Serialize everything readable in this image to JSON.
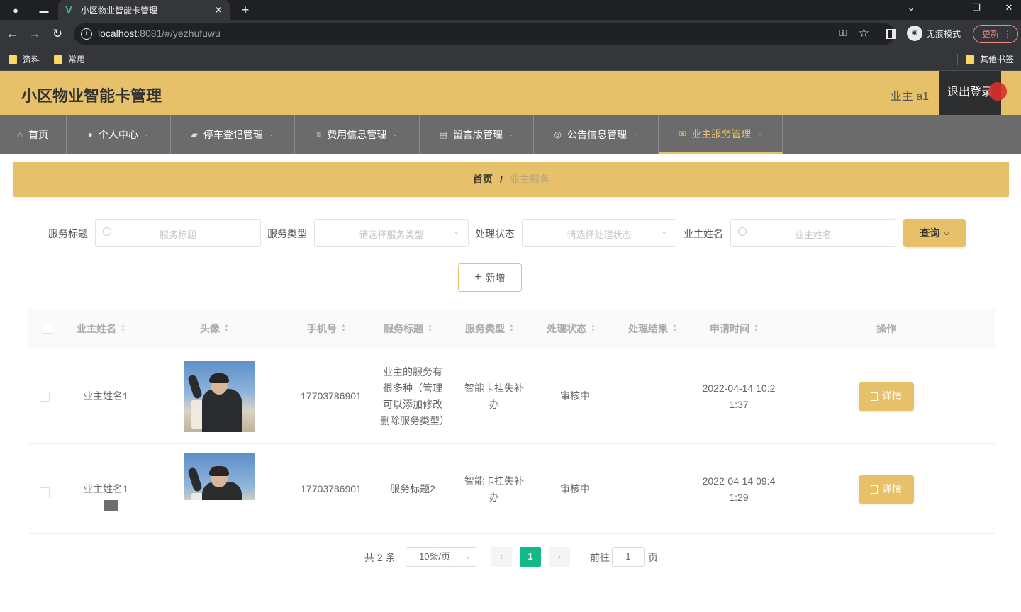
{
  "browser": {
    "tab_title": "小区物业智能卡管理",
    "tab_logo": "V",
    "url_host": "localhost",
    "url_rest": ":8081/#/yezhufuwu",
    "incognito_label": "无痕模式",
    "update_label": "更新",
    "bookmarks": [
      "资料",
      "常用"
    ],
    "other_bookmarks": "其他书签",
    "icons": [
      "back-icon",
      "forward-icon",
      "reload-icon",
      "info-icon",
      "key-icon",
      "star-icon",
      "sidepanel-icon"
    ]
  },
  "header": {
    "title": "小区物业智能卡管理",
    "user": "业主 a1",
    "logout": "退出登录"
  },
  "menu": [
    {
      "label": "首页",
      "icon": "home-icon"
    },
    {
      "label": "个人中心",
      "icon": "user-icon"
    },
    {
      "label": "停车登记管理",
      "icon": "briefcase-icon"
    },
    {
      "label": "费用信息管理",
      "icon": "list-icon"
    },
    {
      "label": "留言版管理",
      "icon": "clipboard-icon"
    },
    {
      "label": "公告信息管理",
      "icon": "bell-icon"
    },
    {
      "label": "业主服务管理",
      "icon": "mail-icon",
      "active": true
    }
  ],
  "breadcrumb": {
    "home": "首页",
    "sep": "/",
    "current": "业主服务"
  },
  "search": {
    "title_label": "服务标题",
    "title_placeholder": "服务标题",
    "type_label": "服务类型",
    "type_placeholder": "请选择服务类型",
    "status_label": "处理状态",
    "status_placeholder": "请选择处理状态",
    "owner_label": "业主姓名",
    "owner_placeholder": "业主姓名",
    "query_button": "查询"
  },
  "add_button": "新增",
  "table": {
    "columns": [
      "业主姓名",
      "头像",
      "手机号",
      "服务标题",
      "服务类型",
      "处理状态",
      "处理结果",
      "申请时间",
      "操作"
    ],
    "rows": [
      {
        "owner": "业主姓名1",
        "phone": "17703786901",
        "title": "业主的服务有很多种（管理可以添加修改删除服务类型）",
        "type": "智能卡挂失补办",
        "status": "审核中",
        "result": "",
        "time": "2022-04-14 10:21:37",
        "action": "详情"
      },
      {
        "owner": "业主姓名1",
        "phone": "17703786901",
        "title": "服务标题2",
        "type": "智能卡挂失补办",
        "status": "审核中",
        "result": "",
        "time": "2022-04-14 09:41:29",
        "action": "详情"
      }
    ]
  },
  "pagination": {
    "total": "共 2 条",
    "page_size": "10条/页",
    "current_page": "1",
    "goto_label": "前往",
    "goto_value": "1",
    "page_unit": "页"
  },
  "colors": {
    "accent": "#e6c16a",
    "menu_bg": "#6b6b6b",
    "page_active": "#13b889"
  }
}
